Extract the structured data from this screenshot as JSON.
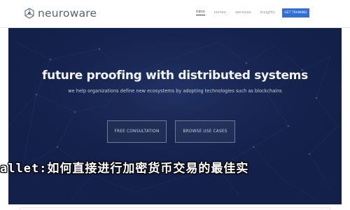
{
  "brand": {
    "name": "neuroware"
  },
  "nav": {
    "items": [
      "intro",
      "cortex",
      "services",
      "insights"
    ],
    "active_index": 0,
    "cta_label": "GET TRAINING"
  },
  "hero": {
    "title": "future proofing with distributed systems",
    "subtitle": "we help organizations define new ecosystems by adopting technologies such as blockchains",
    "primary_button": "FREE CONSULTATION",
    "secondary_button": "BROWSE USE CASES"
  },
  "overlay": {
    "text": "allet:如何直接进行加密货币交易的最佳实"
  },
  "colors": {
    "hero_bg": "#13204a",
    "accent": "#2f6fd6",
    "header_bg": "#ffffff"
  }
}
